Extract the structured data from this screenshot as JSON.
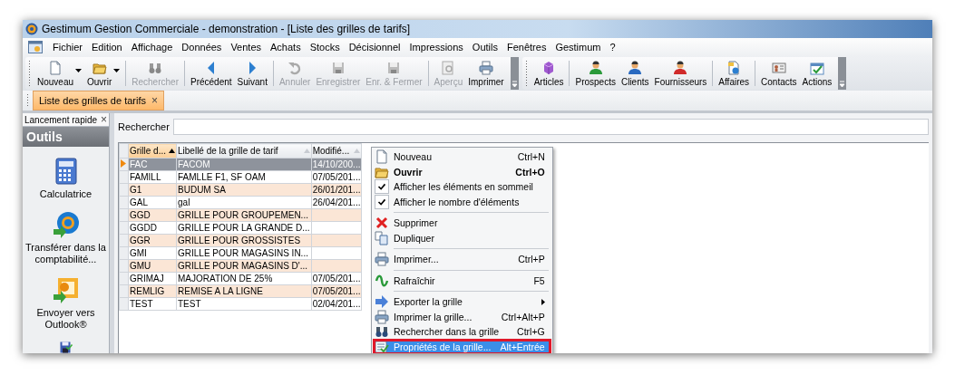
{
  "window": {
    "title": "Gestimum Gestion Commerciale - demonstration - [Liste des grilles de tarifs]"
  },
  "menu_bar": [
    "Fichier",
    "Edition",
    "Affichage",
    "Données",
    "Ventes",
    "Achats",
    "Stocks",
    "Décisionnel",
    "Impressions",
    "Outils",
    "Fenêtres",
    "Gestimum",
    "?"
  ],
  "toolbars": [
    {
      "groups": [
        {
          "buttons": [
            {
              "label": "Nouveau",
              "disabled": false,
              "dropdown": true
            },
            {
              "label": "Ouvrir",
              "disabled": false,
              "dropdown": true
            }
          ]
        },
        {
          "buttons": [
            {
              "label": "Rechercher",
              "disabled": true,
              "dropdown": false
            }
          ]
        },
        {
          "buttons": [
            {
              "label": "Précédent",
              "disabled": false,
              "dropdown": false
            },
            {
              "label": "Suivant",
              "disabled": false,
              "dropdown": false
            }
          ]
        },
        {
          "buttons": [
            {
              "label": "Annuler",
              "disabled": true,
              "dropdown": false
            },
            {
              "label": "Enregistrer",
              "disabled": true,
              "dropdown": false
            },
            {
              "label": "Enr. & Fermer",
              "disabled": true,
              "dropdown": false
            }
          ]
        },
        {
          "buttons": [
            {
              "label": "Aperçu",
              "disabled": true,
              "dropdown": false
            },
            {
              "label": "Imprimer",
              "disabled": false,
              "dropdown": false
            }
          ]
        }
      ]
    },
    {
      "groups": [
        {
          "buttons": [
            {
              "label": "Articles",
              "disabled": false,
              "dropdown": false
            }
          ]
        },
        {
          "buttons": [
            {
              "label": "Prospects",
              "disabled": false,
              "dropdown": false
            },
            {
              "label": "Clients",
              "disabled": false,
              "dropdown": false
            },
            {
              "label": "Fournisseurs",
              "disabled": false,
              "dropdown": false
            }
          ]
        },
        {
          "buttons": [
            {
              "label": "Affaires",
              "disabled": false,
              "dropdown": false
            }
          ]
        },
        {
          "buttons": [
            {
              "label": "Contacts",
              "disabled": false,
              "dropdown": false
            },
            {
              "label": "Actions",
              "disabled": false,
              "dropdown": false
            }
          ]
        }
      ]
    }
  ],
  "document_tabs": [
    {
      "label": "Liste des grilles de tarifs",
      "selected": true,
      "close": "×"
    }
  ],
  "quick_launch": {
    "title": "Lancement rapide",
    "close": "×",
    "section": "Outils",
    "items": [
      {
        "label": "Calculatrice"
      },
      {
        "label": "Transférer dans la comptabilité..."
      },
      {
        "label": "Envoyer vers Outlook®"
      }
    ]
  },
  "search": {
    "label": "Rechercher"
  },
  "table": {
    "columns": [
      {
        "label": "Grille d...",
        "sorted": true
      },
      {
        "label": "Libellé de la grille de tarif",
        "sorted": false
      },
      {
        "label": "Modifié...",
        "sorted": false
      }
    ],
    "rows": [
      {
        "cells": [
          "FAC",
          "FACOM",
          "14/10/200..."
        ],
        "selected": true
      },
      {
        "cells": [
          "FAMILL",
          "FAMLLE F1, SF OAM",
          "07/05/201..."
        ],
        "selected": false
      },
      {
        "cells": [
          "G1",
          "BUDUM SA",
          "26/01/201..."
        ],
        "selected": false
      },
      {
        "cells": [
          "GAL",
          "gal",
          "26/04/201..."
        ],
        "selected": false
      },
      {
        "cells": [
          "GGD",
          "GRILLE POUR GROUPEMEN...",
          ""
        ],
        "selected": false
      },
      {
        "cells": [
          "GGDD",
          "GRILLE POUR LA GRANDE D...",
          ""
        ],
        "selected": false
      },
      {
        "cells": [
          "GGR",
          "GRILLE POUR GROSSISTES",
          ""
        ],
        "selected": false
      },
      {
        "cells": [
          "GMI",
          "GRILLE POUR MAGASINS IN...",
          ""
        ],
        "selected": false
      },
      {
        "cells": [
          "GMU",
          "GRILLE POUR MAGASINS D'...",
          ""
        ],
        "selected": false
      },
      {
        "cells": [
          "GRIMAJ",
          "MAJORATION DE 25%",
          "07/05/201..."
        ],
        "selected": false
      },
      {
        "cells": [
          "REMLIG",
          "REMISE A LA LIGNE",
          "07/05/201..."
        ],
        "selected": false
      },
      {
        "cells": [
          "TEST",
          "TEST",
          "02/04/201..."
        ],
        "selected": false
      }
    ]
  },
  "context_menu": {
    "groups": [
      [
        {
          "label": "Nouveau",
          "shortcut": "Ctrl+N",
          "bold": false,
          "selected": false
        },
        {
          "label": "Ouvrir",
          "shortcut": "Ctrl+O",
          "bold": true,
          "selected": false
        },
        {
          "label": "Afficher les éléments en sommeil",
          "checked": true,
          "bold": false,
          "selected": false
        },
        {
          "label": "Afficher le nombre d'éléments",
          "checked": true,
          "bold": false,
          "selected": false
        }
      ],
      [
        {
          "label": "Supprimer",
          "bold": false,
          "selected": false
        },
        {
          "label": "Dupliquer",
          "bold": false,
          "selected": false
        }
      ],
      [
        {
          "label": "Imprimer...",
          "shortcut": "Ctrl+P",
          "bold": false,
          "selected": false
        }
      ],
      [
        {
          "label": "Rafraîchir",
          "shortcut": "F5",
          "bold": false,
          "selected": false
        }
      ],
      [
        {
          "label": "Exporter la grille",
          "submenu": true,
          "bold": false,
          "selected": false
        },
        {
          "label": "Imprimer la grille...",
          "shortcut": "Ctrl+Alt+P",
          "bold": false,
          "selected": false
        },
        {
          "label": "Rechercher dans la grille",
          "shortcut": "Ctrl+G",
          "bold": false,
          "selected": false
        },
        {
          "label": "Propriétés de la grille...",
          "shortcut": "Alt+Entrée",
          "bold": false,
          "selected": true,
          "highlighted": true
        }
      ]
    ]
  }
}
